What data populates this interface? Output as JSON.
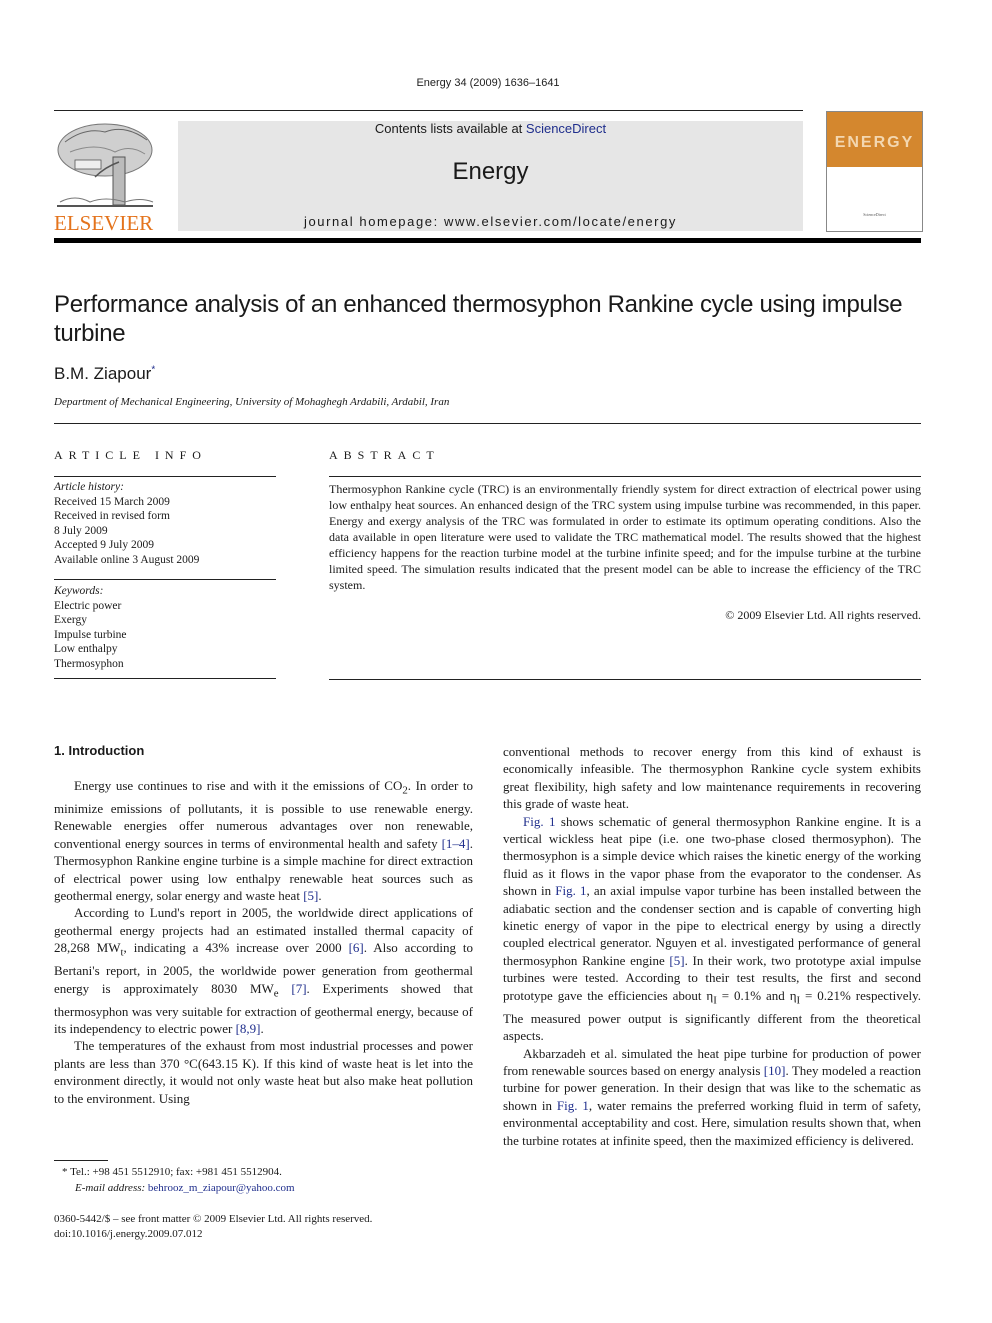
{
  "header": {
    "journal_ref": "Energy 34 (2009) 1636–1641",
    "publisher_logo_text": "ELSEVIER",
    "contents_prefix": "Contents lists available at ",
    "contents_link": "ScienceDirect",
    "journal_title": "Energy",
    "homepage": "journal homepage: www.elsevier.com/locate/energy",
    "cover_word": "ENERGY",
    "colors": {
      "elsevier_orange": "#e4731c",
      "cover_orange": "#d4872e",
      "link_blue": "#1f2e8c",
      "banner_gray": "#e6e6e6"
    }
  },
  "article": {
    "title": "Performance analysis of an enhanced thermosyphon Rankine cycle using impulse turbine",
    "author": "B.M. Ziapour",
    "author_mark": "*",
    "affiliation": "Department of Mechanical Engineering, University of Mohaghegh Ardabili, Ardabil, Iran"
  },
  "article_info": {
    "heading": "ARTICLE INFO",
    "history_label": "Article history:",
    "history": [
      "Received 15 March 2009",
      "Received in revised form",
      "8 July 2009",
      "Accepted 9 July 2009",
      "Available online 3 August 2009"
    ],
    "keywords_label": "Keywords:",
    "keywords": [
      "Electric power",
      "Exergy",
      "Impulse turbine",
      "Low enthalpy",
      "Thermosyphon"
    ]
  },
  "abstract": {
    "heading": "ABSTRACT",
    "text": "Thermosyphon Rankine cycle (TRC) is an environmentally friendly system for direct extraction of electrical power using low enthalpy heat sources. An enhanced design of the TRC system using impulse turbine was recommended, in this paper. Energy and exergy analysis of the TRC was formulated in order to estimate its optimum operating conditions. Also the data available in open literature were used to validate the TRC mathematical model. The results showed that the highest efficiency happens for the reaction turbine model at the turbine infinite speed; and for the impulse turbine at the turbine limited speed. The simulation results indicated that the present model can be able to increase the efficiency of the TRC system.",
    "copyright": "© 2009 Elsevier Ltd. All rights reserved."
  },
  "introduction": {
    "heading": "1.  Introduction",
    "left_paragraphs": [
      [
        "Energy use continues to rise and with it the emissions of CO",
        "2",
        ". In order to minimize emissions of pollutants, it is possible to use renewable energy. Renewable energies offer numerous advantages over non renewable, conventional energy sources in terms of environmental health and safety ",
        "[1–4]",
        ". Thermosyphon Rankine engine turbine is a simple machine for direct extraction of electrical power using low enthalpy renewable heat sources such as geothermal energy, solar energy and waste heat ",
        "[5]",
        "."
      ],
      [
        "According to Lund's report in 2005, the worldwide direct applications of geothermal energy projects had an estimated installed thermal capacity of 28,268 MW",
        "t",
        ", indicating a 43% increase over 2000 ",
        "[6]",
        ". Also according to Bertani's report, in 2005, the worldwide power generation from geothermal energy is approximately 8030 MW",
        "e",
        " ",
        "[7]",
        ". Experiments showed that thermosyphon was very suitable for extraction of geothermal energy, because of its independency to electric power ",
        "[8,9]",
        "."
      ],
      [
        "The temperatures of the exhaust from most industrial processes and power plants are less than 370 °C(643.15 K). If this kind of waste heat is let into the environment directly, it would not only waste heat but also make heat pollution to the environment. Using"
      ]
    ],
    "right_paragraphs": [
      [
        "conventional methods to recover energy from this kind of exhaust is economically infeasible. The thermosyphon Rankine cycle system exhibits great flexibility, high safety and low maintenance requirements in recovering this grade of waste heat."
      ],
      [
        "Fig. 1",
        " shows schematic of general thermosyphon Rankine engine. It is a vertical wickless heat pipe (i.e. one two-phase closed thermosyphon). The thermosyphon is a simple device which raises the kinetic energy of the working fluid as it flows in the vapor phase from the evaporator to the condenser. As shown in ",
        "Fig. 1",
        ", an axial impulse vapor turbine has been installed between the adiabatic section and the condenser section and is capable of converting high kinetic energy of vapor in the pipe to electrical energy by using a directly coupled electrical generator. Nguyen et al. investigated performance of general thermosyphon Rankine engine ",
        "[5]",
        ". In their work, two prototype axial impulse turbines were tested. According to their test results, the first and second prototype gave the efficiencies about η",
        "I",
        " = 0.1% and η",
        "I",
        " = 0.21% respectively. The measured power output is significantly different from the theoretical aspects."
      ],
      [
        "Akbarzadeh et al. simulated the heat pipe turbine for production of power from renewable sources based on energy analysis ",
        "[10]",
        ". They modeled a reaction turbine for power generation. In their design that was like to the schematic as shown in ",
        "Fig. 1",
        ", water remains the preferred working fluid in term of safety, environmental acceptability and cost. Here, simulation results shown that, when the turbine rotates at infinite speed, then the maximized efficiency is delivered."
      ]
    ]
  },
  "footnote": {
    "mark": "*",
    "contact": "Tel.: +98 451 5512910; fax: +981 451 5512904.",
    "email_label": "E-mail address:",
    "email": "behrooz_m_ziapour@yahoo.com"
  },
  "front_matter": {
    "issn_line": "0360-5442/$ – see front matter © 2009 Elsevier Ltd. All rights reserved.",
    "doi": "doi:10.1016/j.energy.2009.07.012"
  }
}
